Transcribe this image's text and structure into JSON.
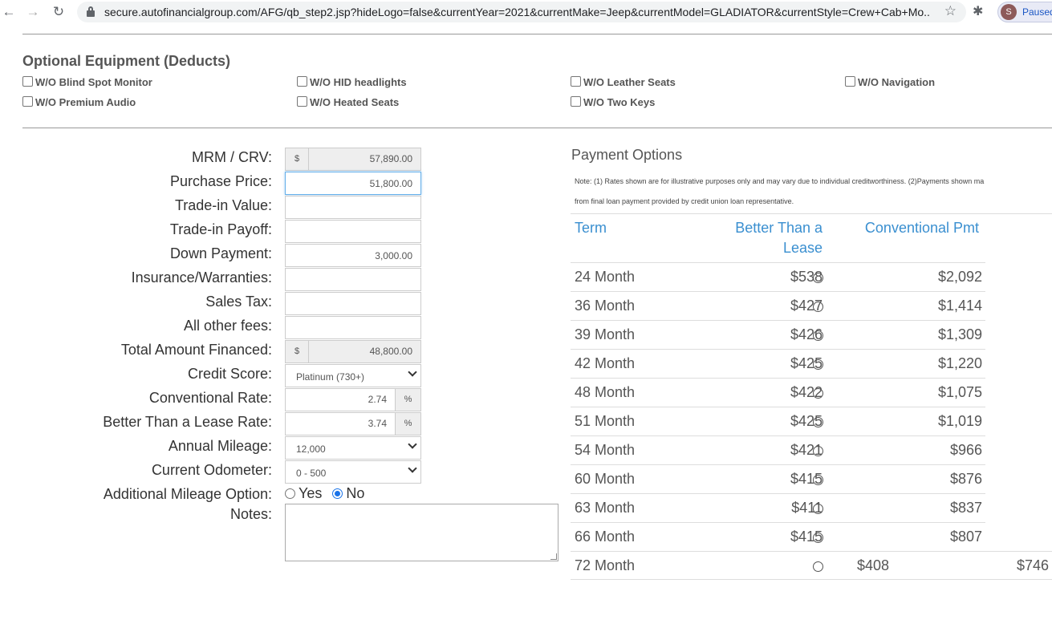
{
  "browser": {
    "url": "secure.autofinancialgroup.com/AFG/qb_step2.jsp?hideLogo=false&currentYear=2021&currentMake=Jeep&currentModel=GLADIATOR&currentStyle=Crew+Cab+Mo...",
    "profile_initial": "S",
    "profile_status": "Paused"
  },
  "optional_equipment": {
    "title": "Optional Equipment (Deducts)",
    "items": [
      "W/O Blind Spot Monitor",
      "W/O HID headlights",
      "W/O Leather Seats",
      "W/O Navigation",
      "W/O Premium Audio",
      "W/O Heated Seats",
      "W/O Two Keys"
    ]
  },
  "form": {
    "currency_symbol": "$",
    "percent_symbol": "%",
    "labels": {
      "mrm": "MRM / CRV:",
      "purchase_price": "Purchase Price:",
      "trade_in_value": "Trade-in Value:",
      "trade_in_payoff": "Trade-in Payoff:",
      "down_payment": "Down Payment:",
      "insurance": "Insurance/Warranties:",
      "sales_tax": "Sales Tax:",
      "other_fees": "All other fees:",
      "total_financed": "Total Amount Financed:",
      "credit_score": "Credit Score:",
      "conventional_rate": "Conventional Rate:",
      "btl_rate": "Better Than a Lease Rate:",
      "annual_mileage": "Annual Mileage:",
      "current_odometer": "Current Odometer:",
      "additional_mileage": "Additional Mileage Option:",
      "notes": "Notes:"
    },
    "values": {
      "mrm": "57,890.00",
      "purchase_price": "51,800.00",
      "trade_in_value": "",
      "trade_in_payoff": "",
      "down_payment": "3,000.00",
      "insurance": "",
      "sales_tax": "",
      "other_fees": "",
      "total_financed": "48,800.00",
      "credit_score": "Platinum (730+)",
      "conventional_rate": "2.74",
      "btl_rate": "3.74",
      "annual_mileage": "12,000",
      "current_odometer": "0 - 500",
      "notes": ""
    },
    "additional_mileage_options": {
      "yes": "Yes",
      "no": "No",
      "selected": "No"
    }
  },
  "payment_options": {
    "title": "Payment Options",
    "note_line1": "Note: (1) Rates shown are for illustrative purposes only and may vary due to individual creditworthiness. (2)Payments shown ma",
    "note_line2": "from final loan payment provided by credit union loan representative.",
    "headers": {
      "term": "Term",
      "btl_line1": "Better Than a",
      "btl_line2": "Lease",
      "conventional": "Conventional Pmt"
    },
    "rows": [
      {
        "term": "24 Month",
        "btl": "$538",
        "conv": "$2,092"
      },
      {
        "term": "36 Month",
        "btl": "$427",
        "conv": "$1,414"
      },
      {
        "term": "39 Month",
        "btl": "$426",
        "conv": "$1,309"
      },
      {
        "term": "42 Month",
        "btl": "$425",
        "conv": "$1,220"
      },
      {
        "term": "48 Month",
        "btl": "$422",
        "conv": "$1,075"
      },
      {
        "term": "51 Month",
        "btl": "$425",
        "conv": "$1,019"
      },
      {
        "term": "54 Month",
        "btl": "$421",
        "conv": "$966"
      },
      {
        "term": "60 Month",
        "btl": "$415",
        "conv": "$876"
      },
      {
        "term": "63 Month",
        "btl": "$411",
        "conv": "$837"
      },
      {
        "term": "66 Month",
        "btl": "$415",
        "conv": "$807"
      },
      {
        "term": "72 Month",
        "btl": "$408",
        "conv": "$746"
      }
    ]
  }
}
